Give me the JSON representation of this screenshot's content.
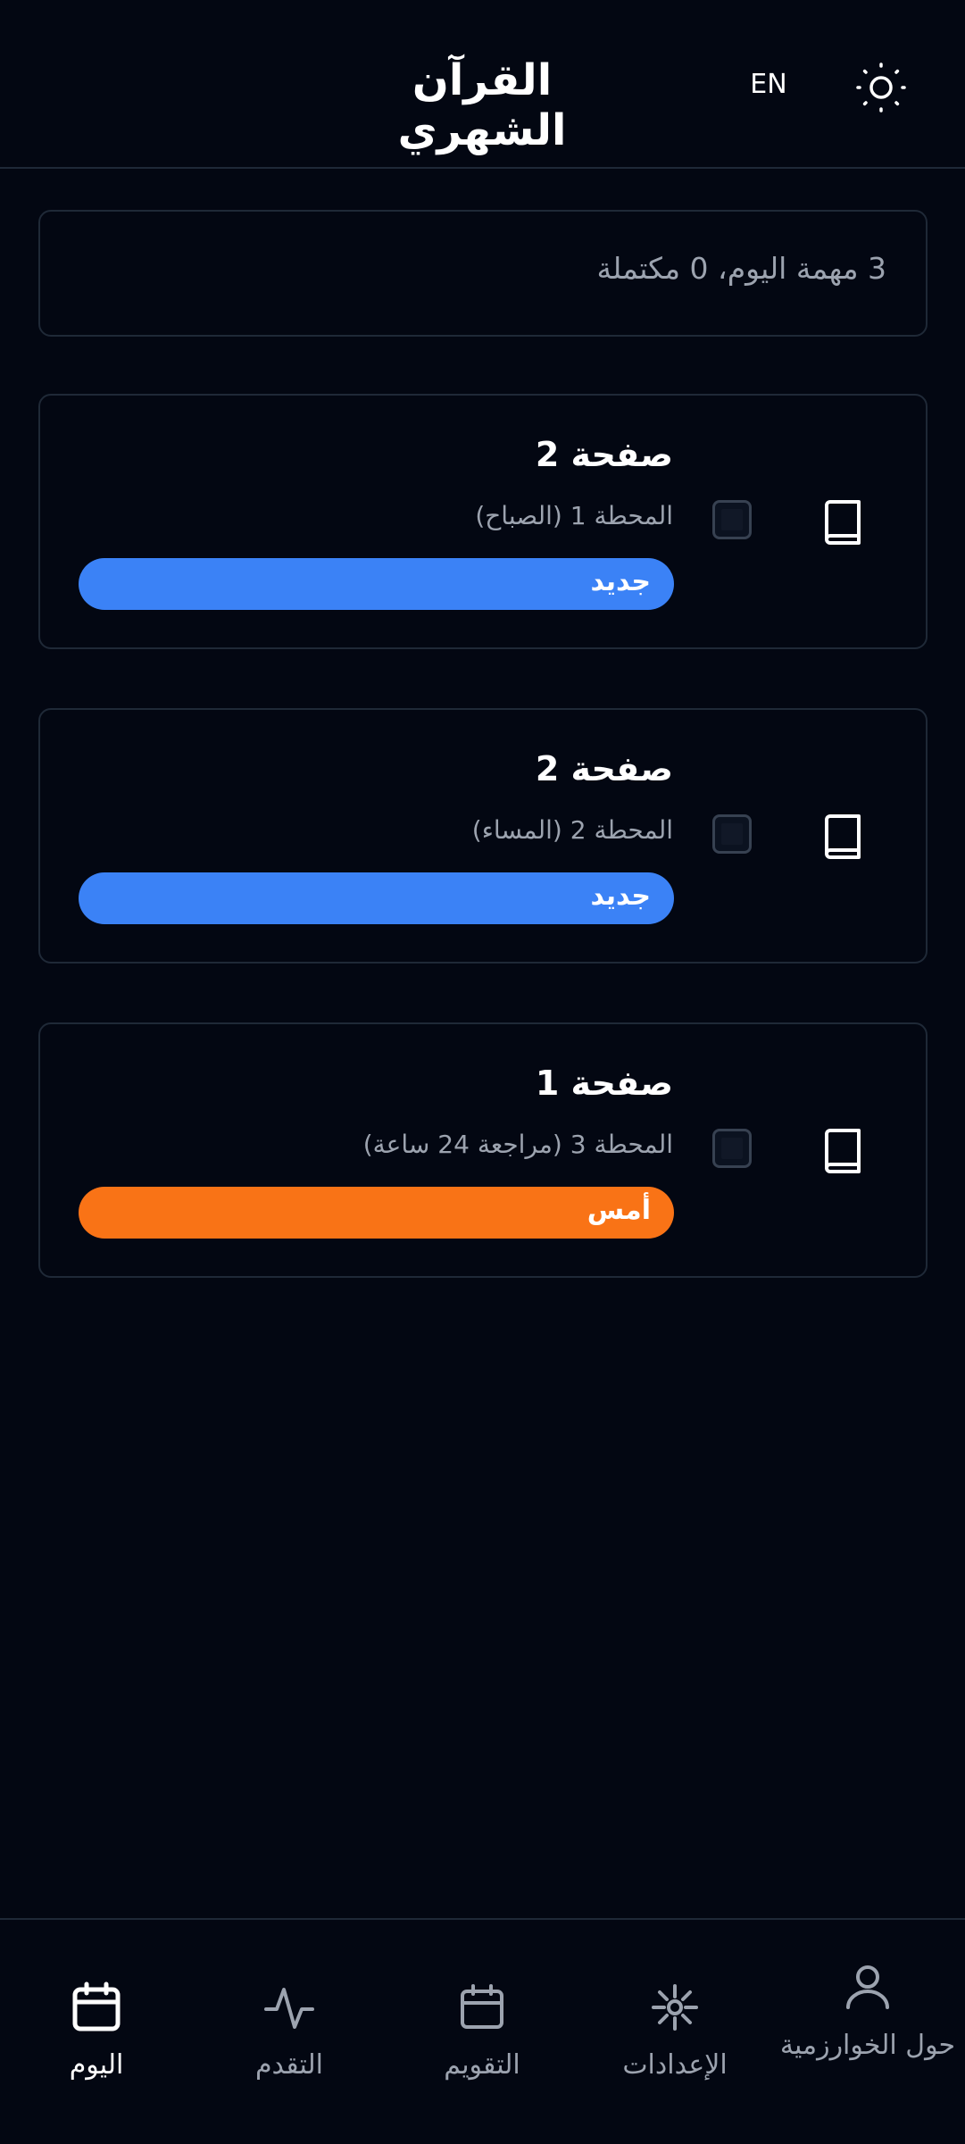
{
  "header": {
    "title": "القرآن الشهري",
    "lang_toggle": "EN",
    "theme_icon": "sun-icon"
  },
  "summary": {
    "text": "3 مهمة اليوم، 0 مكتملة"
  },
  "tasks": [
    {
      "title": "صفحة 2",
      "subtitle": "المحطة 1 (الصباح)",
      "badge": "جديد",
      "badge_color": "#3b82f6",
      "checked": false,
      "icon": "book-icon"
    },
    {
      "title": "صفحة 2",
      "subtitle": "المحطة 2 (المساء)",
      "badge": "جديد",
      "badge_color": "#3b82f6",
      "checked": false,
      "icon": "book-icon"
    },
    {
      "title": "صفحة 1",
      "subtitle": "المحطة 3 (مراجعة 24 ساعة)",
      "badge": "أمس",
      "badge_color": "#f97316",
      "checked": false,
      "icon": "book-icon"
    }
  ],
  "nav": {
    "items": [
      {
        "label": "اليوم",
        "icon": "calendar-icon",
        "active": true
      },
      {
        "label": "التقدم",
        "icon": "activity-icon",
        "active": false
      },
      {
        "label": "التقويم",
        "icon": "calendar-icon",
        "active": false
      },
      {
        "label": "الإعدادات",
        "icon": "settings-icon",
        "active": false
      },
      {
        "label": "حول الخوارزمية",
        "icon": "user-icon",
        "active": false
      }
    ]
  },
  "colors": {
    "background": "#030712",
    "border": "#1f2937",
    "muted_text": "#9ca3af",
    "new_badge": "#3b82f6",
    "yesterday_badge": "#f97316"
  }
}
